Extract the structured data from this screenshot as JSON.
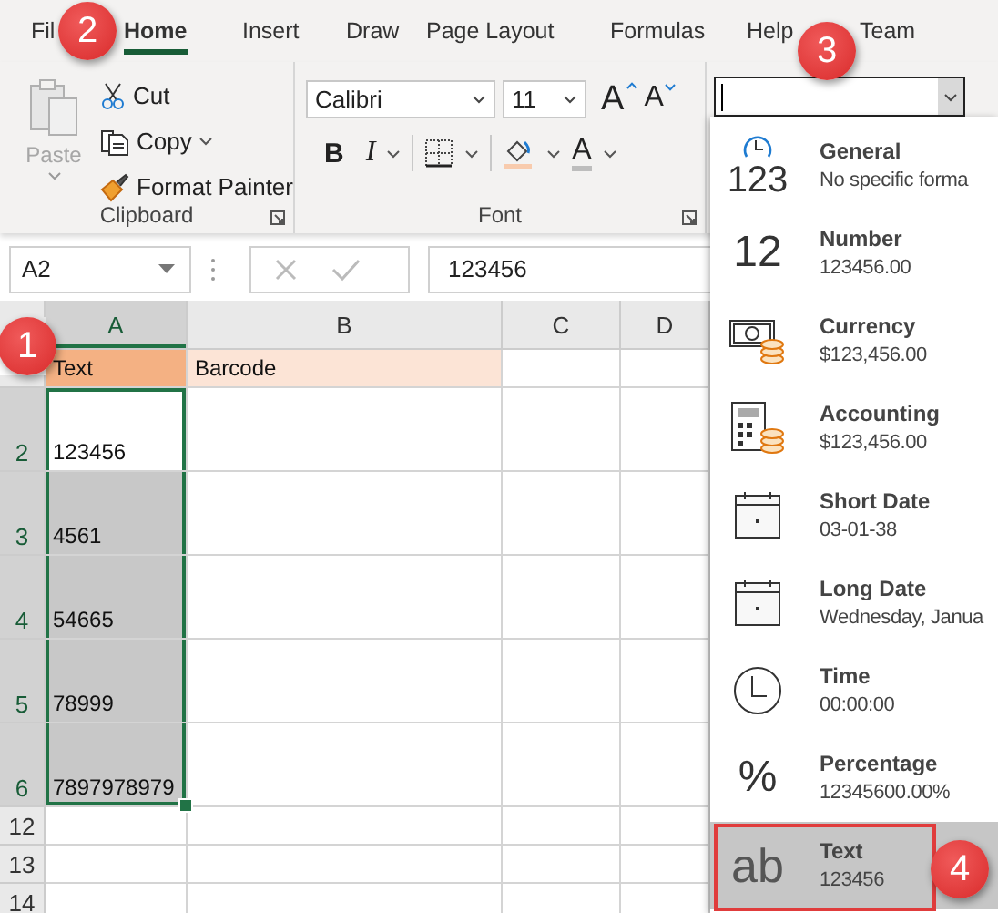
{
  "tabs": [
    {
      "label": "Fil",
      "selected": false
    },
    {
      "label": "Home",
      "selected": true
    },
    {
      "label": "Insert",
      "selected": false
    },
    {
      "label": "Draw",
      "selected": false
    },
    {
      "label": "Page Layout",
      "selected": false
    },
    {
      "label": "Formulas",
      "selected": false
    },
    {
      "label": "Help",
      "selected": false
    },
    {
      "label": "Team",
      "selected": false
    }
  ],
  "clipboard": {
    "title": "Clipboard",
    "paste": "Paste",
    "cut": "Cut",
    "copy": "Copy",
    "format_painter": "Format Painter",
    "paste_disabled": true
  },
  "font": {
    "title": "Font",
    "family": "Calibri",
    "size": "11",
    "grow": "A",
    "shrink": "A",
    "bold": "B",
    "italic": "I",
    "font_color_letter": "A"
  },
  "formula_bar": {
    "name_box": "A2",
    "formula": "123456"
  },
  "columns": [
    {
      "label": "A",
      "selected": true
    },
    {
      "label": "B",
      "selected": false
    },
    {
      "label": "C",
      "selected": false
    },
    {
      "label": "D",
      "selected": false
    }
  ],
  "rows": [
    {
      "selected": false,
      "tall": false,
      "cells": [
        {
          "text": "Text",
          "color": "#f4b183"
        },
        {
          "text": "Barcode",
          "color": "#fce4d6"
        },
        {},
        {}
      ]
    },
    {
      "header": "2",
      "selected": true,
      "tall": true,
      "cells": [
        {
          "text": "123456",
          "active": true
        },
        {},
        {},
        {}
      ]
    },
    {
      "header": "3",
      "selected": true,
      "tall": true,
      "cells": [
        {
          "text": "4561",
          "active": false
        },
        {},
        {},
        {}
      ]
    },
    {
      "header": "4",
      "selected": true,
      "tall": true,
      "cells": [
        {
          "text": "54665",
          "active": false
        },
        {},
        {},
        {}
      ]
    },
    {
      "header": "5",
      "selected": true,
      "tall": true,
      "cells": [
        {
          "text": "78999",
          "active": false
        },
        {},
        {},
        {}
      ]
    },
    {
      "header": "6",
      "selected": true,
      "tall": true,
      "cells": [
        {
          "text": "7897978979",
          "active": false
        },
        {},
        {},
        {}
      ]
    },
    {
      "header": "12",
      "selected": false,
      "tall": false,
      "cells": [
        {},
        {},
        {},
        {}
      ]
    },
    {
      "header": "13",
      "selected": false,
      "tall": false,
      "cells": [
        {},
        {},
        {},
        {}
      ]
    },
    {
      "header": "14",
      "selected": false,
      "tall": false,
      "cells": [
        {},
        {},
        {},
        {}
      ]
    }
  ],
  "formats": [
    {
      "kind": "general",
      "glyph": "123",
      "name": "General",
      "example": "No specific forma",
      "selected": false
    },
    {
      "kind": "number",
      "glyph": "12",
      "name": "Number",
      "example": "123456.00",
      "selected": false
    },
    {
      "kind": "currency",
      "name": "Currency",
      "example": "$123,456.00",
      "selected": false
    },
    {
      "kind": "accounting",
      "name": "Accounting",
      "example": "$123,456.00",
      "selected": false
    },
    {
      "kind": "calendar",
      "name": "Short Date",
      "example": "03-01-38",
      "selected": false
    },
    {
      "kind": "calendar",
      "name": "Long Date",
      "example": "Wednesday, Janua",
      "selected": false
    },
    {
      "kind": "clock",
      "name": "Time",
      "example": "00:00:00",
      "selected": false
    },
    {
      "kind": "percentage",
      "glyph": "%",
      "name": "Percentage",
      "example": "12345600.00%",
      "selected": false
    },
    {
      "kind": "text",
      "glyph": "ab",
      "name": "Text",
      "example": "123456",
      "selected": true
    }
  ],
  "callouts": [
    {
      "label": "1"
    },
    {
      "label": "2"
    },
    {
      "label": "3"
    },
    {
      "label": "4"
    }
  ]
}
